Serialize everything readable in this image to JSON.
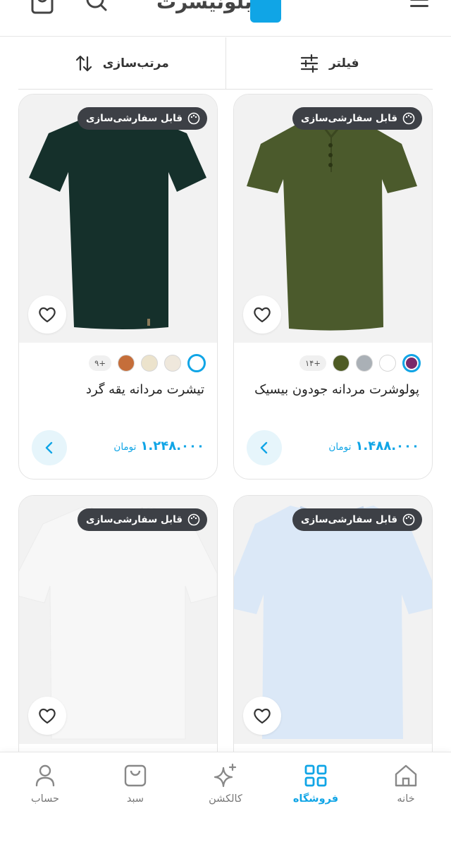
{
  "header": {
    "brand_text": "بلونیسرت",
    "icons": [
      "menu-icon",
      "search-icon",
      "bag-icon"
    ]
  },
  "toolbar": {
    "filter_label": "فیلتر",
    "sort_label": "مرتب‌سازی"
  },
  "products": [
    {
      "badge": "قابل سفارشی‌سازی",
      "title": "پولوشرت مردانه جودون بیسیک",
      "price": "۱.۴۸۸.۰۰۰",
      "currency": "تومان",
      "more_colors": "+۱۴",
      "colors": [
        "#7a2a6a",
        "#ffffff",
        "#aab0b6",
        "#4e5b24"
      ],
      "shirt_color": "#4b5a2c",
      "shirt_type": "polo"
    },
    {
      "badge": "قابل سفارشی‌سازی",
      "title": "تیشرت مردانه یقه گرد",
      "price": "۱.۲۴۸.۰۰۰",
      "currency": "تومان",
      "more_colors": "+۹",
      "colors": [
        "#ffffff",
        "#efe8dc",
        "#ece3cc",
        "#c56e3a"
      ],
      "shirt_color": "#15302b",
      "shirt_type": "tee"
    },
    {
      "badge": "قابل سفارشی‌سازی",
      "title": "",
      "price": "",
      "currency": "",
      "more_colors": "",
      "colors": [],
      "shirt_color": "#dbe8f7",
      "shirt_type": "oversize"
    },
    {
      "badge": "قابل سفارشی‌سازی",
      "title": "",
      "price": "",
      "currency": "",
      "more_colors": "",
      "colors": [],
      "shirt_color": "#f7f7f7",
      "shirt_type": "tee"
    }
  ],
  "bottom_nav": {
    "items": [
      {
        "label": "حساب",
        "icon": "user-icon",
        "active": false
      },
      {
        "label": "سبد",
        "icon": "cart-icon",
        "active": false
      },
      {
        "label": "کالکشن",
        "icon": "sparkle-icon",
        "active": false
      },
      {
        "label": "فروشگاه",
        "icon": "grid-icon",
        "active": true
      },
      {
        "label": "خانه",
        "icon": "home-icon",
        "active": false
      }
    ]
  },
  "colors": {
    "accent": "#10a5e6",
    "badge_bg": "#3d4046"
  }
}
